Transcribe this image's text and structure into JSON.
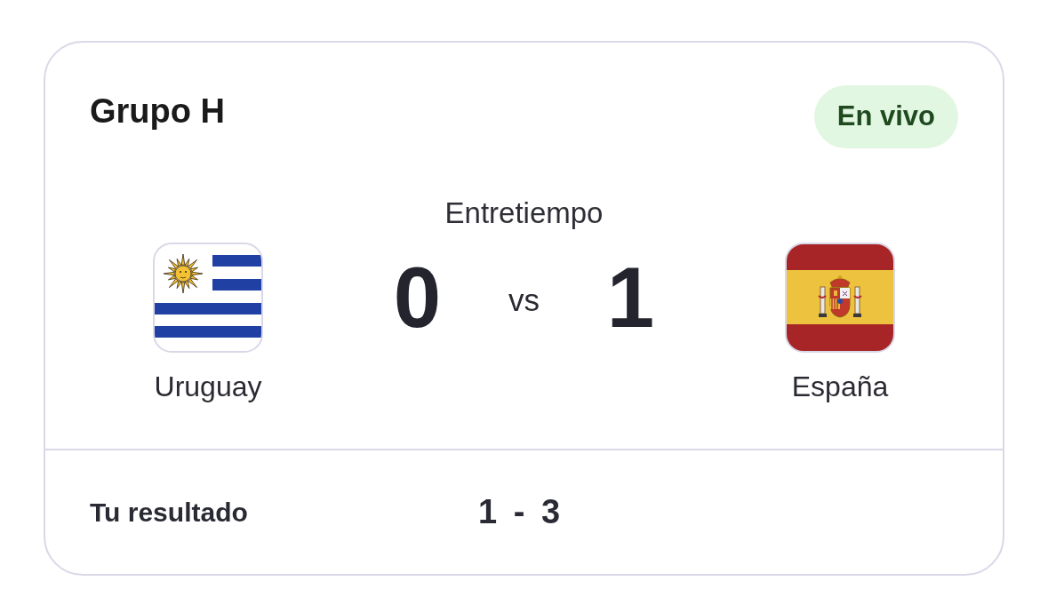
{
  "group": {
    "title": "Grupo H"
  },
  "status_badge": {
    "label": "En vivo"
  },
  "match": {
    "period": "Entretiempo",
    "home": {
      "name": "Uruguay",
      "score": "0"
    },
    "separator": "vs",
    "away": {
      "name": "España",
      "score": "1"
    }
  },
  "prediction": {
    "label": "Tu resultado",
    "score": "1 - 3"
  }
}
